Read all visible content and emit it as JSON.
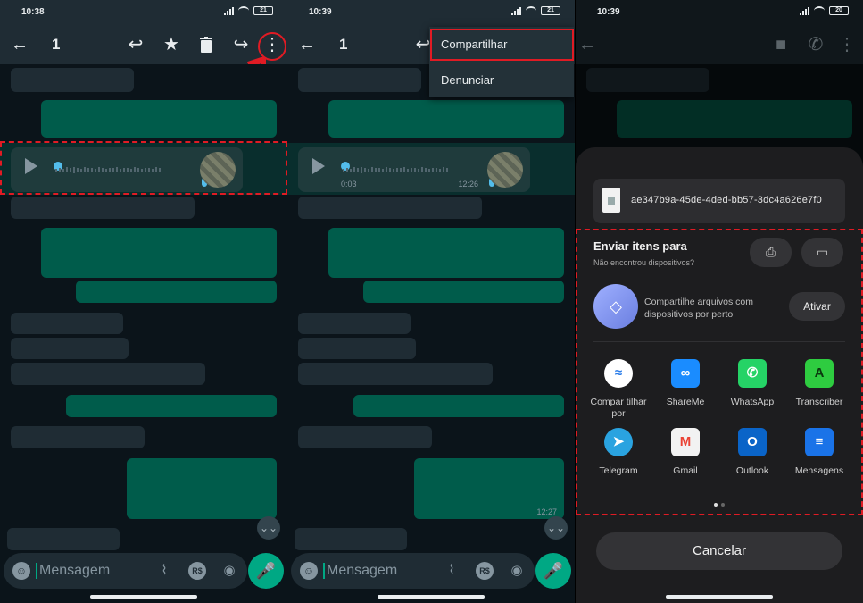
{
  "panel1": {
    "status": {
      "time": "10:38",
      "battery": "21"
    },
    "toolbar": {
      "selected_count": "1",
      "back_icon": "arrow-left-icon",
      "reply_icon": "reply-icon",
      "star_icon": "star-icon",
      "delete_icon": "trash-icon",
      "forward_icon": "forward-icon",
      "more_icon": "more-vertical-icon"
    },
    "input": {
      "placeholder": "Mensagem"
    },
    "annotation_color": "#e01b24"
  },
  "panel2": {
    "status": {
      "time": "10:39",
      "battery": "21"
    },
    "toolbar": {
      "selected_count": "1"
    },
    "voice": {
      "elapsed": "0:03",
      "time": "12:26"
    },
    "last_msg_time": "12:27",
    "menu": {
      "items": [
        "Compartilhar",
        "Denunciar"
      ]
    },
    "input": {
      "placeholder": "Mensagem"
    }
  },
  "panel3": {
    "status": {
      "time": "10:39",
      "battery": "20"
    },
    "file": {
      "name": "ae347b9a-45de-4ded-bb57-3dc4a626e7f0"
    },
    "send": {
      "title": "Enviar itens para",
      "subtitle": "Não encontrou dispositivos?"
    },
    "nearby": {
      "text": "Compartilhe arquivos com dispositivos por perto",
      "button": "Ativar"
    },
    "apps": [
      {
        "label": "Compar tilhar por",
        "icon": "nearby-share-icon",
        "color": "#ffffff"
      },
      {
        "label": "ShareMe",
        "icon": "shareme-icon",
        "color": "#1a8cff"
      },
      {
        "label": "WhatsApp",
        "icon": "whatsapp-icon",
        "color": "#25d366"
      },
      {
        "label": "Transcriber",
        "icon": "transcriber-icon",
        "color": "#2ecc40"
      },
      {
        "label": "Telegram",
        "icon": "telegram-icon",
        "color": "#2aa3e0"
      },
      {
        "label": "Gmail",
        "icon": "gmail-icon",
        "color": "#ea4335"
      },
      {
        "label": "Outlook",
        "icon": "outlook-icon",
        "color": "#0a64c8"
      },
      {
        "label": "Mensagens",
        "icon": "messages-icon",
        "color": "#1a73e8"
      }
    ],
    "cancel": "Cancelar"
  }
}
